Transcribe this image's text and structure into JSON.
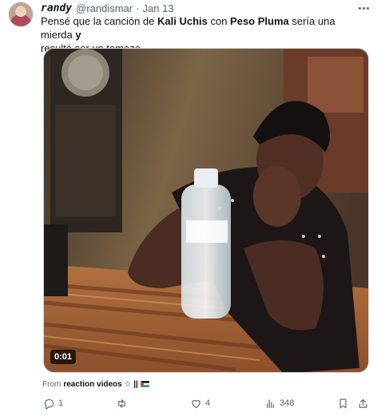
{
  "tweet": {
    "display_name": "randy",
    "handle": "@randismar",
    "separator": "·",
    "date": "Jan 13",
    "text_parts": [
      "Pensé que la canción de ",
      "Kali Uchis",
      " con ",
      "Peso Pluma",
      " sería una mierda ",
      "y",
      " resultó ser un temazo"
    ],
    "media": {
      "duration": "0:01"
    },
    "attribution": {
      "from": "From",
      "channel": "reaction videos",
      "suffix": "☆ ||"
    },
    "actions": {
      "replies": "1",
      "retweets": "",
      "likes": "4",
      "views": "348"
    }
  }
}
